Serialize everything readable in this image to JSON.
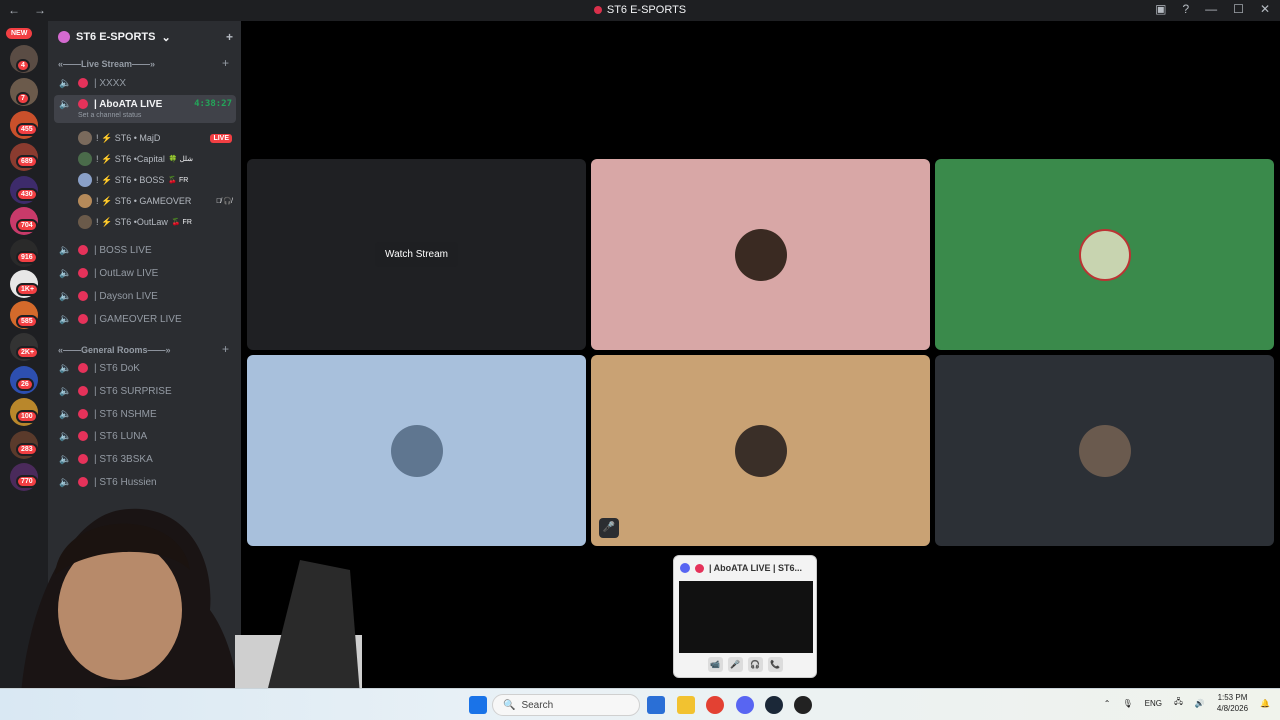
{
  "window": {
    "title": "ST6 E-SPORTS",
    "back_glyph": "←",
    "forward_glyph": "→"
  },
  "rail": {
    "new_label": "NEW",
    "badges": [
      "4",
      "7",
      "455",
      "689",
      "430",
      "704",
      "916",
      "1K+",
      "585",
      "2K+",
      "26",
      "100",
      "283",
      "770"
    ]
  },
  "server": {
    "name": "ST6 E-SPORTS",
    "chevron": "⌄",
    "invite_glyph": "+"
  },
  "categories": {
    "live": "«——Live Stream——»",
    "general": "«——General Rooms——»"
  },
  "channels_live": [
    {
      "name": "| XXXX"
    },
    {
      "name": "| AboATA LIVE",
      "timer": "4:38:27",
      "status": "Set a channel status"
    },
    {
      "name": "| BOSS LIVE"
    },
    {
      "name": "| OutLaw LIVE"
    },
    {
      "name": "| Dayson LIVE"
    },
    {
      "name": "| GAMEOVER LIVE"
    }
  ],
  "voice_users": [
    {
      "name": "! ⚡ ST6 • MajD",
      "badge": "LIVE"
    },
    {
      "name": "! ⚡ ST6 •Capital",
      "tag": "🍀 شلل"
    },
    {
      "name": "! ⚡ ST6 • BOSS",
      "tag": "🍒 FR"
    },
    {
      "name": "! ⚡ ST6 • GAMEOVER",
      "tag": "🎙̸ 🎧̸"
    },
    {
      "name": "! ⚡ ST6 •OutLaw",
      "tag": "🍒 FR"
    }
  ],
  "channels_general": [
    {
      "name": "| ST6 DoK"
    },
    {
      "name": "| ST6 SURPRISE"
    },
    {
      "name": "| ST6 NSHME"
    },
    {
      "name": "| ST6 LUNA"
    },
    {
      "name": "| ST6 3BSKA"
    },
    {
      "name": "| ST6 Hussien"
    }
  ],
  "stage": {
    "watch_stream_label": "Watch Stream",
    "tile_colors": [
      "#1f2023",
      "#d8a7a6",
      "#3a8a4b",
      "#a8c0dc",
      "#c9a274",
      "#2c3036"
    ]
  },
  "pip": {
    "title": "| AboATA LIVE | ST6...",
    "controls": [
      "📹",
      "🎤",
      "🎧",
      "📞"
    ]
  },
  "taskbar": {
    "search_placeholder": "Search",
    "language": "ENG",
    "time": "1:53 PM",
    "date": "4/8/2026"
  }
}
